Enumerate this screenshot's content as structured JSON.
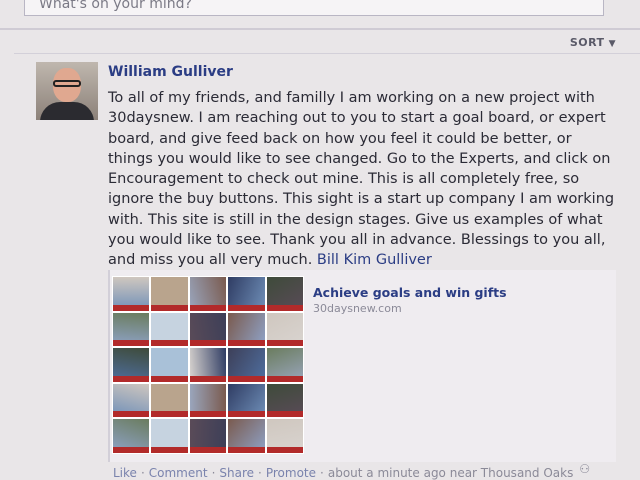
{
  "composer": {
    "placeholder": "What's on your mind?"
  },
  "feed": {
    "sort_label": "SORT"
  },
  "post": {
    "author": "William Gulliver",
    "text": "To all of my friends, and familly I am working on a new project with 30daysnew. I am reaching out to you to start a goal board, or expert board, and give feed back on how you feel it could be better, or things you would like to see changed. Go to the Experts, and click on Encouragement to check out mine. This is all completely free, so ignore the buy buttons. This sight is a start up company I am working with. This site is still in the design stages. Give us examples of what you would like to see. Thank you all in advance. Blessings to you all, and miss you all very much.",
    "mention": "Bill Kim Gulliver",
    "shared_link": {
      "title": "Achieve goals and win gifts",
      "domain": "30daysnew.com"
    },
    "actions": {
      "like": "Like",
      "comment": "Comment",
      "share": "Share",
      "promote": "Promote",
      "timestamp": "about a minute ago near Thousand Oaks"
    }
  },
  "colors": {
    "link_blue": "#2b3d84",
    "background": "#e9e6e8",
    "collage_label_red": "#b22a2a"
  },
  "icons": {
    "sort_caret": "chevron-down-icon",
    "privacy": "people-icon"
  }
}
